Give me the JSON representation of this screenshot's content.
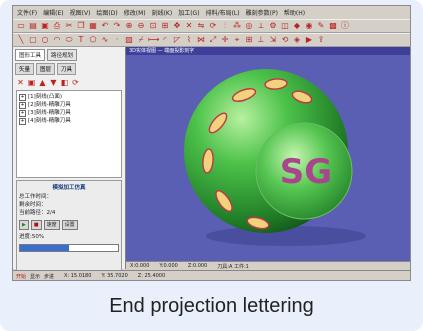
{
  "menu": [
    "文件(F)",
    "编辑(E)",
    "视图(V)",
    "绘图(D)",
    "修改(M)",
    "刻线(K)",
    "加工(G)",
    "排料/布局(L)",
    "雕刻参数(P)",
    "帮助(H)"
  ],
  "left_panel": {
    "tabs": [
      "图形工具",
      "路径规划"
    ],
    "subtabs": [
      "矢量",
      "图层",
      "刀具"
    ],
    "tree": [
      "[1]刻线(凸面)",
      "[2]刻线-精雕刀具",
      "[3]刻线-精雕刀具",
      "[4]刻线-精雕刀具"
    ],
    "panel_title": "模拟加工仿真",
    "info": [
      "总工作时间：",
      "剩余时间：",
      "当前路径：2/4"
    ],
    "buttons": {
      "play": "▶",
      "stop": "■",
      "speed": "速度",
      "set": "设置"
    },
    "progress_label": "进度:50%",
    "progress": 0.5
  },
  "view": {
    "title": "3D实体视图 — 端面投影刻字",
    "logo_text": "SG"
  },
  "status": [
    "X:0.000",
    "Y:0.000",
    "Z:0.000",
    "刀具:A 工件:1"
  ],
  "taskbar": [
    "开始",
    "显示",
    "步进",
    "X: 15.0180",
    "Y: 35.7020",
    "Z: 25.4000"
  ],
  "caption": "End projection lettering",
  "colors": {
    "viewport": "#5a5fb4",
    "ball": "#32a83a",
    "logo": "#a8458c"
  }
}
